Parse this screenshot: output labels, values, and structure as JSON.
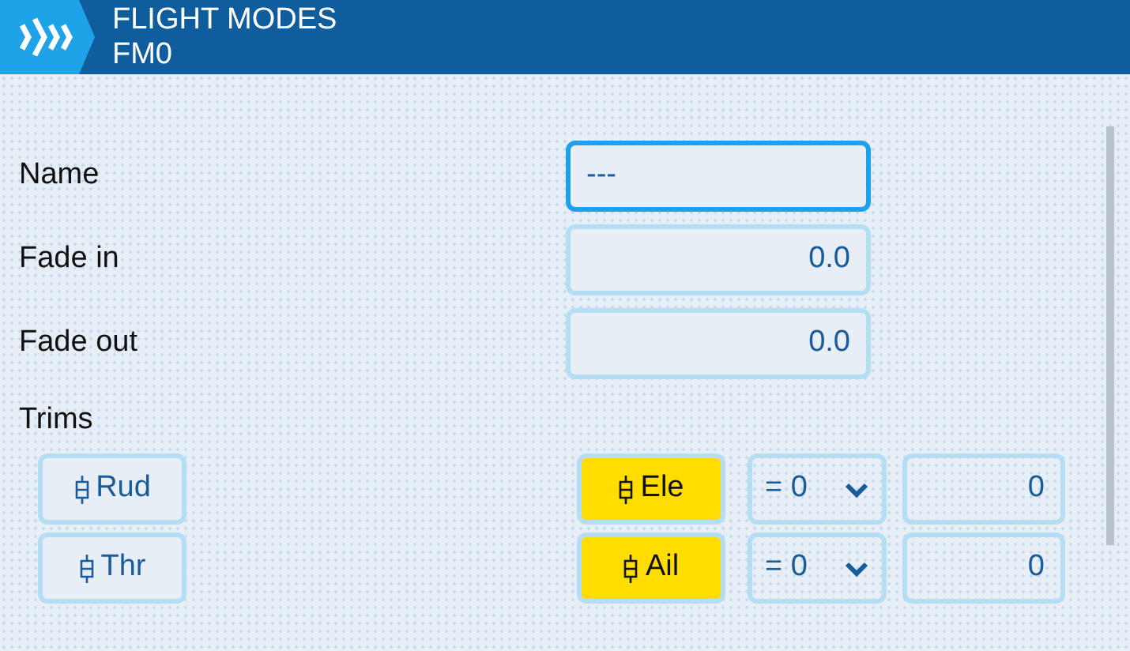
{
  "header": {
    "title": "FLIGHT MODES",
    "subtitle": "FM0"
  },
  "fields": [
    {
      "label": "Name",
      "value": "---",
      "kind": "text",
      "focused": true
    },
    {
      "label": "Fade in",
      "value": "0.0",
      "kind": "number",
      "focused": false
    },
    {
      "label": "Fade out",
      "value": "0.0",
      "kind": "number",
      "focused": false
    }
  ],
  "trims_label": "Trims",
  "trims": [
    {
      "left": {
        "label": "Rud",
        "on": false
      },
      "right": {
        "label": "Ele",
        "on": true
      },
      "mode": "= 0",
      "value": "0"
    },
    {
      "left": {
        "label": "Thr",
        "on": false
      },
      "right": {
        "label": "Ail",
        "on": true
      },
      "mode": "= 0",
      "value": "0"
    }
  ]
}
